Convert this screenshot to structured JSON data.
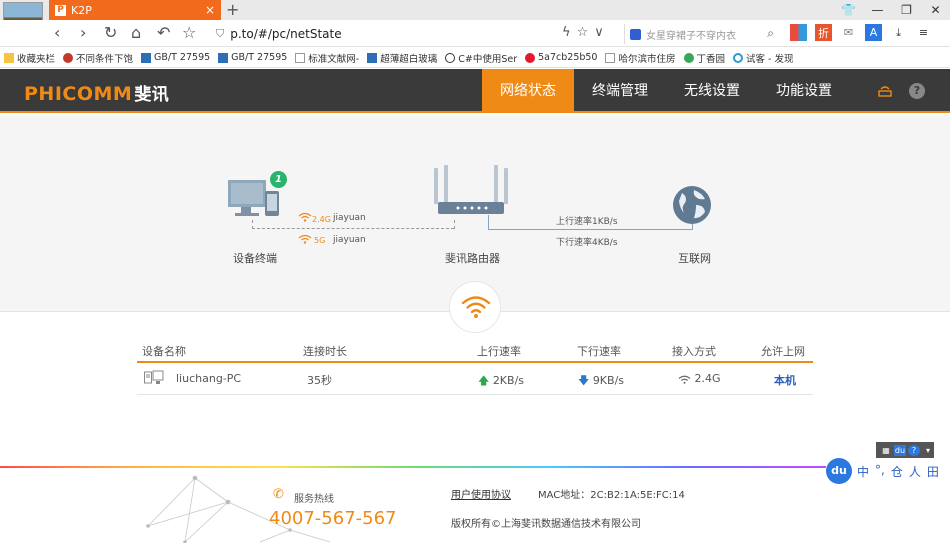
{
  "browser": {
    "tab_title": "K2P",
    "tab_favicon": "P",
    "url": "p.to/#/pc/netState",
    "search_placeholder": "女星穿裙子不穿内衣",
    "bookmarks": [
      {
        "label": "收藏夹栏",
        "icon": "folder-icon"
      },
      {
        "label": "不同条件下饱",
        "icon": "person-icon"
      },
      {
        "label": "GB/T 27595",
        "icon": "doc-icon"
      },
      {
        "label": "GB/T 27595",
        "icon": "doc-icon"
      },
      {
        "label": "标准文献网-",
        "icon": "page-icon"
      },
      {
        "label": "超薄超白玻璃",
        "icon": "doc-icon"
      },
      {
        "label": "C#中使用Ser",
        "icon": "c-icon"
      },
      {
        "label": "5a7cb25b50",
        "icon": "weibo-icon"
      },
      {
        "label": "哈尔滨市住房",
        "icon": "page-icon"
      },
      {
        "label": "丁香园",
        "icon": "flower-icon"
      },
      {
        "label": "试客 - 发现",
        "icon": "ring-icon"
      }
    ]
  },
  "router": {
    "logo": "PHICOMM",
    "logo_cn": "斐讯",
    "nav": [
      "网络状态",
      "终端管理",
      "无线设置",
      "功能设置"
    ],
    "active_nav": "网络状态",
    "accent_color": "#f08a17",
    "topology": {
      "device_label": "设备终端",
      "device_count": "1",
      "band_24": "2.4G",
      "band_5": "5G",
      "ssid_24": "jiayuan",
      "ssid_5": "jiayuan",
      "router_label": "斐讯路由器",
      "upload_rate": "上行速率1KB/s",
      "download_rate": "下行速率4KB/s",
      "internet_label": "互联网"
    },
    "table": {
      "headers": [
        "设备名称",
        "连接时长",
        "上行速率",
        "下行速率",
        "接入方式",
        "允许上网"
      ],
      "rows": [
        {
          "name": "liuchang-PC",
          "duration": "35秒",
          "up": "2KB/s",
          "down": "9KB/s",
          "access": "2.4G",
          "allow": "本机"
        }
      ]
    },
    "footer": {
      "hotline_label": "服务热线",
      "hotline": "4007-567-567",
      "agreement": "用户使用协议",
      "mac": "MAC地址：2C:B2:1A:5E:FC:14",
      "copyright": "版权所有©上海斐讯数据通信技术有限公司"
    }
  },
  "ime": {
    "logo": "du",
    "items": [
      "中",
      "°,",
      "仓",
      "人",
      "田"
    ]
  }
}
